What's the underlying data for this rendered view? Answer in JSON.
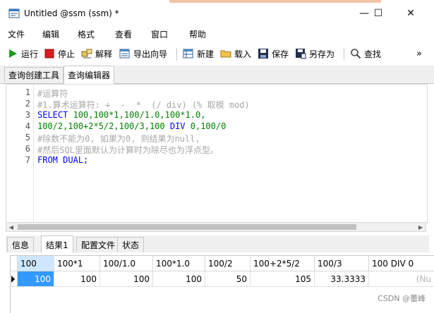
{
  "window": {
    "title": "Untitled @ssm (ssm) *",
    "minimize": "—",
    "maximize": "☐",
    "close": "✕"
  },
  "menu": [
    "文件",
    "编辑",
    "格式",
    "查看",
    "窗口",
    "帮助"
  ],
  "toolbar": {
    "run": "运行",
    "stop": "停止",
    "explain": "解释",
    "export_wizard": "导出向导",
    "new": "新建",
    "load": "载入",
    "save": "保存",
    "save_as": "另存为",
    "find": "查找",
    "more": "»"
  },
  "editor_tabs": [
    "查询创建工具",
    "查询编辑器"
  ],
  "editor": {
    "lines": [
      {
        "n": "1",
        "text": "#运算符"
      },
      {
        "n": "2",
        "text": "#1.算术运算符: +  -  *  (/ div) (% 取模 mod)"
      },
      {
        "n": "3",
        "text": "SELECT 100,100*1,100/1.0,100*1.0,"
      },
      {
        "n": "4",
        "text": "100/2,100+2*5/2,100/3,100 DIV 0,100/0"
      },
      {
        "n": "5",
        "text": "#除数不能为0, 如果为0, 则结果为null,"
      },
      {
        "n": "6",
        "text": "#然后SQL里面默认为计算时为除尽也为浮点型。"
      },
      {
        "n": "7",
        "text": "FROM DUAL;"
      }
    ],
    "tokens": {
      "select": "SELECT",
      "div": "DIV",
      "from": "FROM",
      "dual": "DUAL;",
      "l3_nums": " 100,100*1,100/1.0,100*1.0,",
      "l4_a": "100/2,100+2*5/2,100/3,100 ",
      "l4_b": " 0,100/0"
    }
  },
  "result_tabs": [
    "信息",
    "结果1",
    "配置文件",
    "状态"
  ],
  "grid": {
    "columns": [
      "100",
      "100*1",
      "100/1.0",
      "100*1.0",
      "100/2",
      "100+2*5/2",
      "100/3",
      "100 DIV 0"
    ],
    "row": [
      "100",
      "100",
      "100",
      "100",
      "50",
      "105",
      "33.3333",
      "(Nu"
    ]
  },
  "watermark": "CSDN @蕾峰"
}
